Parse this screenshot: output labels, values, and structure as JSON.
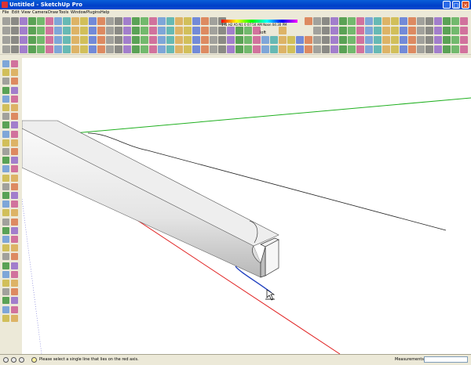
{
  "window": {
    "title": "Untitled - SketchUp Pro"
  },
  "menu": [
    "File",
    "Edit",
    "View",
    "Camera",
    "Draw",
    "Tools",
    "Window",
    "Plugins",
    "Help"
  ],
  "toolbar": {
    "loft_label": "loft",
    "section_value": "",
    "ruler_text": "1 I1 H2 A5 N1 0  07:50 AM   Noon   04:30 PM"
  },
  "status": {
    "message": "Please select a single line that lies on the red axis.",
    "measurements_label": "Measurements",
    "measurements_value": ""
  },
  "colors": {
    "red_axis": "#e02020",
    "green_axis": "#20b020",
    "selected_edge": "#2040c0",
    "beam_face": "#e6e6e6"
  }
}
